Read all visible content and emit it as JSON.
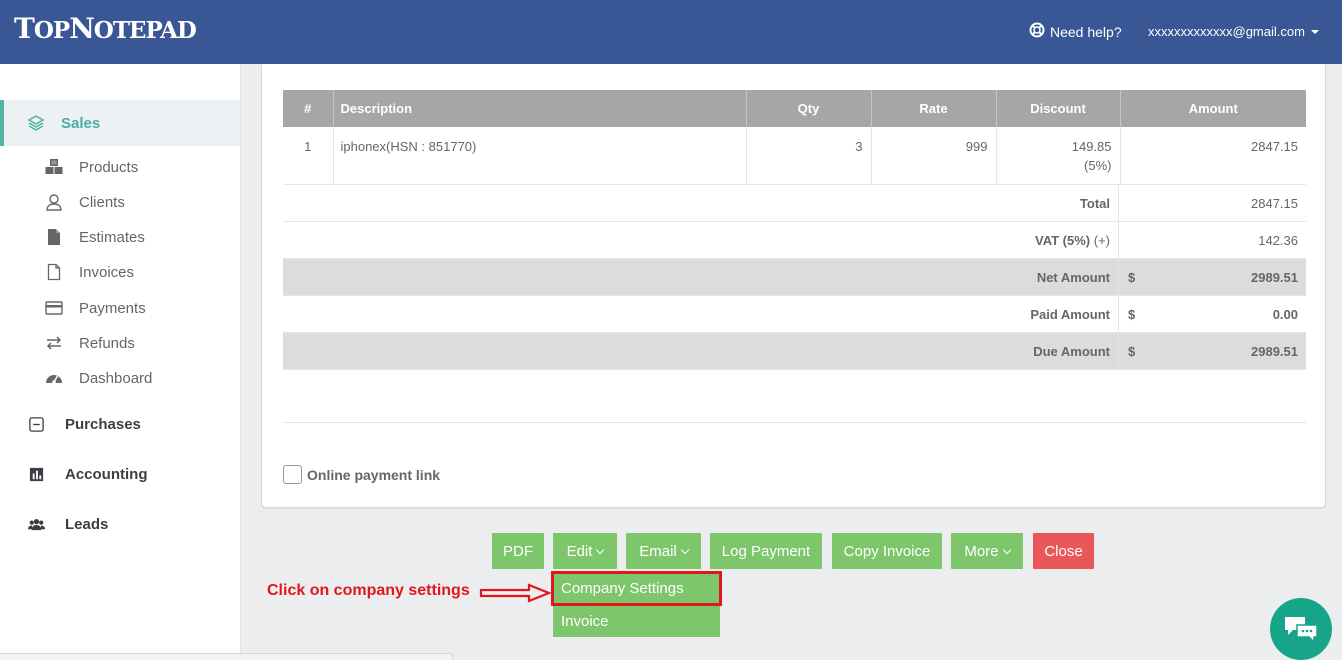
{
  "header": {
    "brand": {
      "first": "T",
      "rest1": "OP",
      "second": "N",
      "rest2": "OTEPAD"
    },
    "help_label": "Need help?",
    "user_email": "xxxxxxxxxxxxx@gmail.com"
  },
  "sidebar": {
    "sales_label": "Sales",
    "sales_items": [
      {
        "label": "Products",
        "icon": "cubes-icon"
      },
      {
        "label": "Clients",
        "icon": "user-icon"
      },
      {
        "label": "Estimates",
        "icon": "file-icon"
      },
      {
        "label": "Invoices",
        "icon": "file-outline-icon"
      },
      {
        "label": "Payments",
        "icon": "credit-card-icon"
      },
      {
        "label": "Refunds",
        "icon": "exchange-icon"
      },
      {
        "label": "Dashboard",
        "icon": "dashboard-icon"
      }
    ],
    "main_items": [
      {
        "label": "Purchases",
        "icon": "minus-square-icon"
      },
      {
        "label": "Accounting",
        "icon": "bar-chart-icon"
      },
      {
        "label": "Leads",
        "icon": "users-icon"
      }
    ]
  },
  "invoice": {
    "columns": [
      "#",
      "Description",
      "Qty",
      "Rate",
      "Discount",
      "Amount"
    ],
    "rows": [
      {
        "no": "1",
        "description": "iphonex(HSN : 851770)",
        "qty": "3",
        "rate": "999",
        "discount": "149.85",
        "discount_pct": "(5%)",
        "amount": "2847.15"
      }
    ],
    "total_label": "Total",
    "total_value": "2847.15",
    "vat_label": "VAT (5%)",
    "vat_sign": "(+)",
    "vat_value": "142.36",
    "net_label": "Net Amount",
    "net_currency": "$",
    "net_value": "2989.51",
    "paid_label": "Paid Amount",
    "paid_currency": "$",
    "paid_value": "0.00",
    "due_label": "Due Amount",
    "due_currency": "$",
    "due_value": "2989.51",
    "online_payment_label": "Online payment link"
  },
  "actions": {
    "pdf": "PDF",
    "edit": "Edit",
    "email": "Email",
    "log_payment": "Log Payment",
    "copy_invoice": "Copy Invoice",
    "more": "More",
    "close": "Close"
  },
  "edit_menu": {
    "company_settings": "Company Settings",
    "invoice": "Invoice"
  },
  "annotation": "Click on company settings",
  "colors": {
    "header": "#3a5795",
    "accent": "#55b4a4",
    "button": "#7ec66b",
    "close": "#e9575a",
    "annotation": "#e0181c"
  }
}
